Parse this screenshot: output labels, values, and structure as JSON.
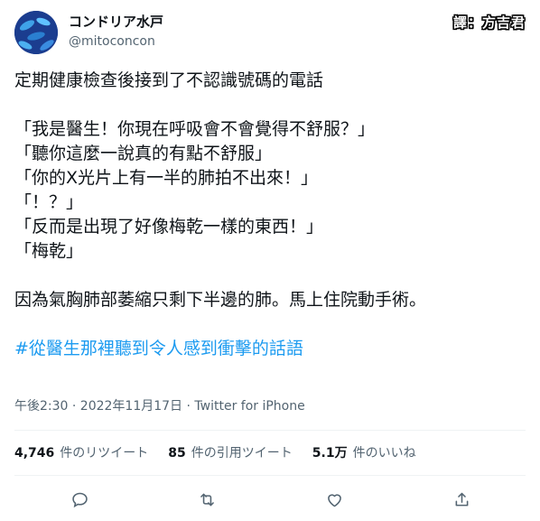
{
  "user": {
    "display_name": "コンドリア水戸",
    "handle": "@mitoconcon"
  },
  "watermark": "譯：方吉君",
  "tweet": {
    "lines": [
      "定期健康檢查後接到了不認識號碼的電話",
      "",
      "「我是醫生！你現在呼吸會不會覺得不舒服？」",
      "「聽你這麼一說真的有點不舒服」",
      "「你的X光片上有一半的肺拍不出來！」",
      "「！？」",
      "「反而是出現了好像梅乾一樣的東西！」",
      "「梅乾」",
      "",
      "因為氣胸肺部萎縮只剩下半邊的肺。馬上住院動手術。",
      ""
    ],
    "hashtag": "#從醫生那裡聽到令人感到衝擊的話語"
  },
  "meta": "午後2:30 · 2022年11月17日 · Twitter for iPhone",
  "stats": {
    "retweets_count": "4,746",
    "retweets_label": "件のリツイート",
    "quotes_count": "85",
    "quotes_label": "件の引用ツイート",
    "likes_count": "5.1万",
    "likes_label": "件のいいね"
  },
  "actions": [
    "reply-icon",
    "retweet-icon",
    "like-icon",
    "share-icon"
  ],
  "colors": {
    "text": "#0f1419",
    "secondary": "#536471",
    "link": "#1d9bf0",
    "divider": "#eff3f4"
  }
}
